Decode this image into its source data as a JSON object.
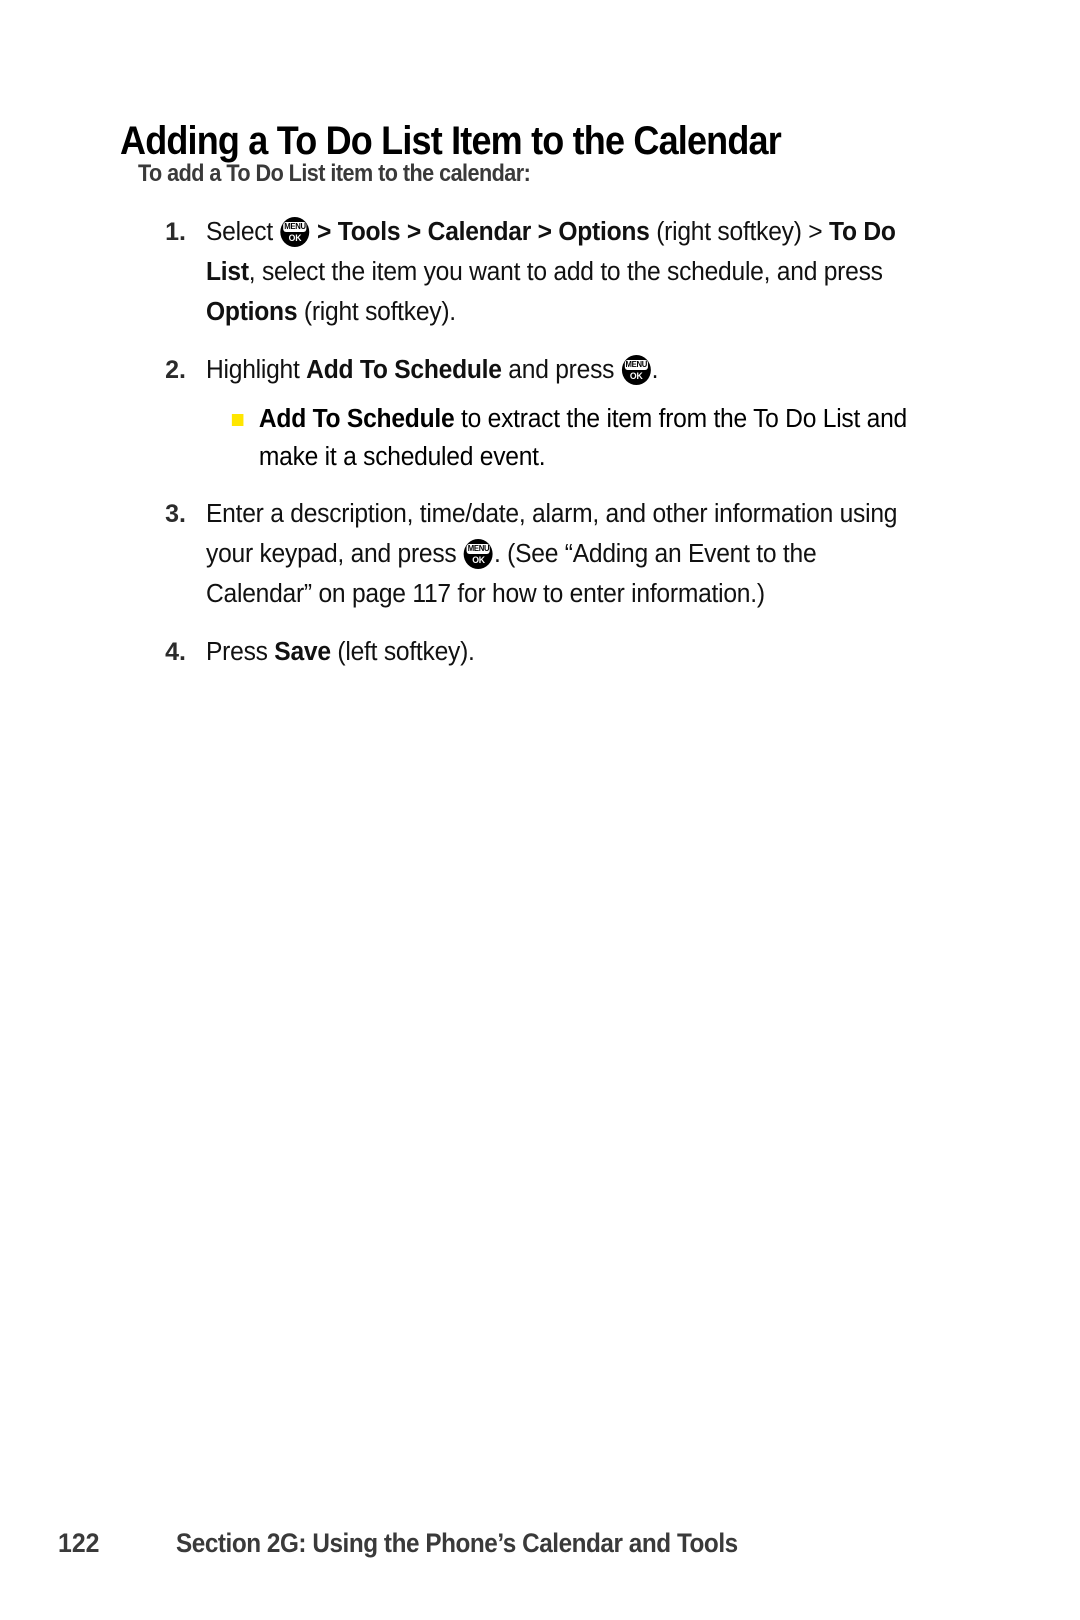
{
  "document": {
    "title": "Adding a To Do List Item to the Calendar",
    "subtitle": "To add a To Do List item to the calendar:"
  },
  "icons": {
    "menu_key": {
      "name": "menu-ok-key-icon",
      "top_label": "MENU",
      "bottom_label": "OK"
    },
    "chevron": "›",
    "square_bullet_color": "#ffe600"
  },
  "steps": [
    {
      "number": "1.",
      "parts": {
        "a": "Select ",
        "b": " > ",
        "c": "Tools",
        "d": " > ",
        "e": "Calendar",
        "f": " > ",
        "g": "Options",
        "h": " (right softkey) > ",
        "i": "To Do List",
        "j": ", select the item you want to add to the schedule, and press ",
        "k": "Options",
        "l": " (right softkey)."
      }
    },
    {
      "number": "2.",
      "parts": {
        "a": "Highlight ",
        "b": "Add To Schedule",
        "c": " and press ",
        "d": "."
      },
      "subitem": {
        "bold": "Add To Schedule",
        "text": " to extract the item from the To Do List and make it a scheduled event."
      }
    },
    {
      "number": "3.",
      "parts": {
        "a": "Enter a description, time/date, alarm, and other information using your keypad, and press ",
        "b": ". (See “Adding an Event to the Calendar” on page 117 for how to enter information.)"
      }
    },
    {
      "number": "4.",
      "parts": {
        "a": "Press ",
        "b": "Save",
        "c": " (left softkey)."
      }
    }
  ],
  "footer": {
    "page_number": "122",
    "section_text": "Section 2G: Using the Phone’s Calendar and Tools"
  }
}
